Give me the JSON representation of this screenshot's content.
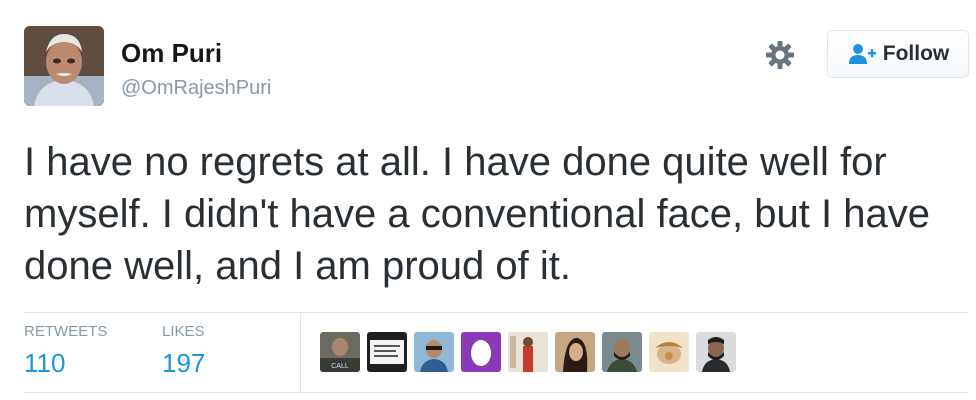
{
  "user": {
    "name": "Om Puri",
    "handle": "@OmRajeshPuri"
  },
  "actions": {
    "follow_label": "Follow"
  },
  "tweet": {
    "text": "I have no regrets at all. I have done quite well for myself. I didn't have a conventional face, but I have done well, and I am proud of it."
  },
  "stats": {
    "retweets_label": "RETWEETS",
    "retweets_count": "110",
    "likes_label": "LIKES",
    "likes_count": "197"
  },
  "likers": [
    {
      "icon": "avatar-photo"
    },
    {
      "icon": "avatar-photo"
    },
    {
      "icon": "avatar-photo"
    },
    {
      "icon": "default-egg-avatar"
    },
    {
      "icon": "avatar-photo"
    },
    {
      "icon": "avatar-photo"
    },
    {
      "icon": "avatar-photo"
    },
    {
      "icon": "avatar-photo"
    },
    {
      "icon": "avatar-photo"
    }
  ],
  "colors": {
    "link_blue": "#1b95e0",
    "muted_gray": "#8899a6",
    "text_dark": "#292f33",
    "egg_purple": "#8a3ab9"
  }
}
